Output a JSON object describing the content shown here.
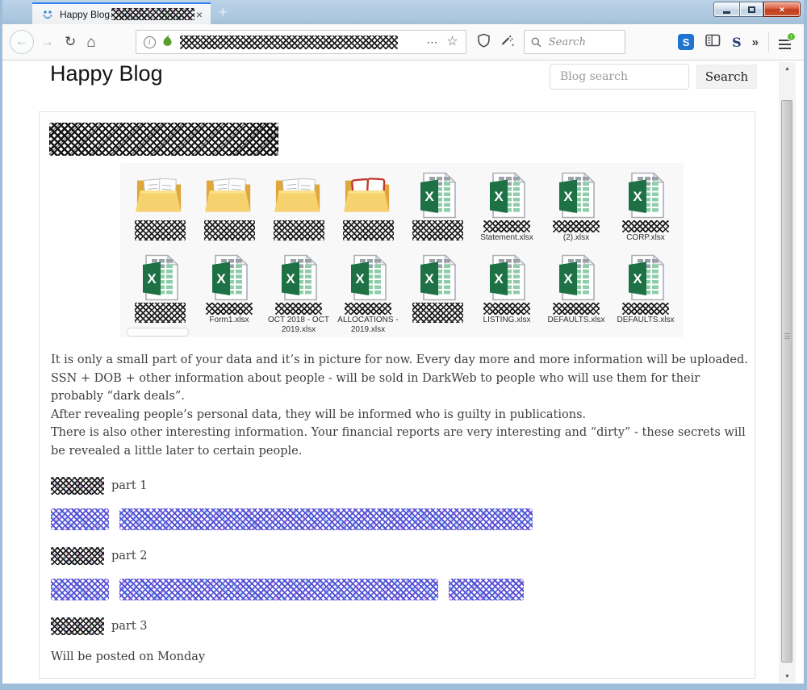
{
  "browser": {
    "tab_title": "Happy Blog",
    "tab_close": "×",
    "new_tab": "+",
    "page_actions": "⋯",
    "bookmark": "☆",
    "overflow": "»",
    "search_placeholder": "Search",
    "ext1_letter": "S",
    "ext2_letter": "S",
    "window_close": "×"
  },
  "icons": {
    "back": "←",
    "forward": "→",
    "refresh": "↻",
    "home": "⌂",
    "scroll_up": "▲",
    "scroll_down": "▼",
    "update_badge": "↑"
  },
  "page": {
    "title": "Happy Blog",
    "blog_search_placeholder": "Blog search",
    "search_button": "Search"
  },
  "post": {
    "files": [
      {
        "type": "folder",
        "label": ""
      },
      {
        "type": "folder",
        "label": ""
      },
      {
        "type": "folder",
        "label": ""
      },
      {
        "type": "folder-red",
        "label": ""
      },
      {
        "type": "excel",
        "label": ""
      },
      {
        "type": "excel",
        "label": "Statement.xlsx"
      },
      {
        "type": "excel",
        "label": "(2).xlsx"
      },
      {
        "type": "excel",
        "label": "CORP.xlsx"
      },
      {
        "type": "excel",
        "label": ""
      },
      {
        "type": "excel",
        "label": "Form1.xlsx"
      },
      {
        "type": "excel",
        "label": "OCT 2018 - OCT 2019.xlsx"
      },
      {
        "type": "excel",
        "label": "ALLOCATIONS - 2019.xlsx"
      },
      {
        "type": "excel",
        "label": ""
      },
      {
        "type": "excel",
        "label": "LISTING.xlsx"
      },
      {
        "type": "excel",
        "label": "DEFAULTS.xlsx"
      },
      {
        "type": "excel",
        "label": "DEFAULTS.xlsx"
      }
    ],
    "body": [
      "It is only a small part of your data and it’s in picture for now. Every day more and more information will be uploaded.",
      "SSN + DOB + other information about people - will be sold in DarkWeb to people who will use them for their probably “dark deals”.",
      "After revealing people’s personal data, they will be informed who is guilty in publications.",
      "There is also other interesting information. Your financial reports are very interesting and “dirty” - these secrets will be revealed a little later to certain people."
    ],
    "parts": [
      "part 1",
      "part 2",
      "part 3"
    ],
    "footer": "Will be posted on Monday"
  },
  "colors": {
    "excel_green": "#1e7145",
    "folder_yellow": "#f6d26e",
    "tab_accent": "#2c83f0",
    "titlebar_blue": "#aac6de",
    "link_scribble_blue": "#4d4dcf",
    "close_button_red": "#c03c1c"
  }
}
